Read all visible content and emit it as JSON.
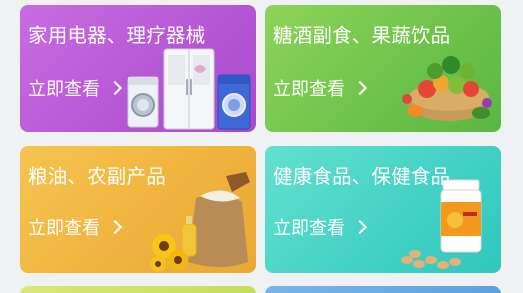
{
  "categories": [
    {
      "title": "家用电器、理疗器械",
      "cta": "立即查看",
      "image": "home-appliances-image"
    },
    {
      "title": "糖酒副食、果蔬饮品",
      "cta": "立即查看",
      "image": "fruits-vegetables-image"
    },
    {
      "title": "粮油、农副产品",
      "cta": "立即查看",
      "image": "grain-oil-image"
    },
    {
      "title": "健康食品、保健食品",
      "cta": "立即查看",
      "image": "health-supplements-image"
    }
  ],
  "colors": {
    "appliances": "#b557d4",
    "groceries": "#6cc24a",
    "grain": "#efb23c",
    "health": "#42d1c4",
    "row3_left": "#c5dc5a",
    "row3_right": "#5b9fde"
  }
}
